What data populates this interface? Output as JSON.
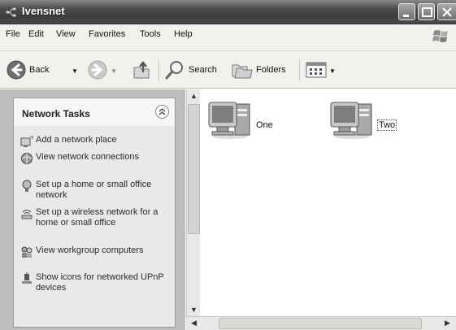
{
  "window": {
    "title": "Ivensnet",
    "icon": "network-icon"
  },
  "menu": {
    "items": [
      "File",
      "Edit",
      "View",
      "Favorites",
      "Tools",
      "Help"
    ]
  },
  "toolbar": {
    "back_label": "Back",
    "search_label": "Search",
    "folders_label": "Folders"
  },
  "tasks": {
    "title": "Network Tasks",
    "items": [
      {
        "label": "Add a network place",
        "icon": "add-network-place-icon"
      },
      {
        "label": "View network connections",
        "icon": "network-connections-icon"
      },
      {
        "label": "Set up a home or small office network",
        "icon": "home-network-icon"
      },
      {
        "label": "Set up a wireless network for a home or small office",
        "icon": "wireless-network-icon"
      },
      {
        "label": "View workgroup computers",
        "icon": "workgroup-icon"
      },
      {
        "label": "Show icons for networked UPnP devices",
        "icon": "upnp-icon"
      }
    ]
  },
  "content": {
    "items": [
      {
        "label": "One",
        "icon": "computer-icon",
        "selected": false
      },
      {
        "label": "Two",
        "icon": "computer-icon",
        "selected": true
      }
    ]
  }
}
